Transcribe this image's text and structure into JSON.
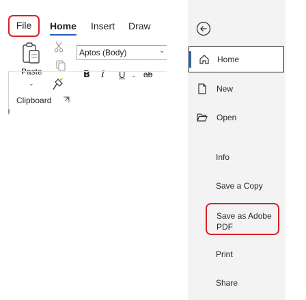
{
  "ribbon": {
    "tabs": [
      {
        "label": "File"
      },
      {
        "label": "Home"
      },
      {
        "label": "Insert"
      },
      {
        "label": "Draw"
      }
    ],
    "paste_label": "Paste",
    "font_name": "Aptos (Body)",
    "format_buttons": {
      "bold": "B",
      "italic": "I",
      "underline": "U",
      "strikethrough": "ab"
    },
    "clipboard_group_label": "Clipboard"
  },
  "backstage": {
    "nav": [
      {
        "label": "Home",
        "icon": "home-icon"
      },
      {
        "label": "New",
        "icon": "new-document-icon"
      },
      {
        "label": "Open",
        "icon": "folder-open-icon"
      },
      {
        "label": "Info"
      },
      {
        "label": "Save a Copy"
      },
      {
        "label": "Save as Adobe PDF"
      },
      {
        "label": "Print"
      },
      {
        "label": "Share"
      }
    ]
  },
  "colors": {
    "highlight_border": "#d71f26",
    "home_tab_underline": "#1f5fbf",
    "backstage_bg": "#f3f3f3",
    "nav_accent": "#2b63b3"
  }
}
